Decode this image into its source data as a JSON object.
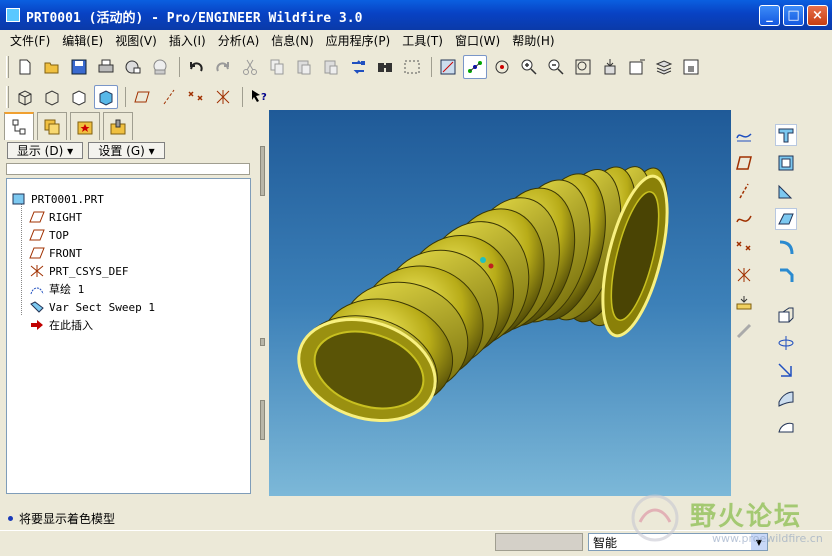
{
  "window": {
    "title": "PRT0001 (活动的) - Pro/ENGINEER Wildfire 3.0",
    "minimize": "_",
    "maximize": "□",
    "close": "×"
  },
  "menu": [
    "文件(F)",
    "编辑(E)",
    "视图(V)",
    "插入(I)",
    "分析(A)",
    "信息(N)",
    "应用程序(P)",
    "工具(T)",
    "窗口(W)",
    "帮助(H)"
  ],
  "toolbar_icons": {
    "row1": [
      "new-file-icon",
      "open-folder-icon",
      "save-icon",
      "print-icon",
      "send-mail-icon",
      "email-link-icon",
      "undo-icon",
      "redo-icon",
      "cut-icon",
      "copy-icon",
      "paste-icon",
      "paste-special-icon",
      "regenerate-icon",
      "find-icon",
      "select-box-icon",
      "datum-display-icon",
      "datum-axis-icon",
      "spin-center-icon",
      "zoom-in-icon",
      "zoom-out-icon",
      "refit-icon",
      "reorient-icon",
      "saved-views-icon",
      "layers-icon",
      "view-manager-icon"
    ],
    "row2": [
      "wireframe-icon",
      "hidden-line-icon",
      "no-hidden-icon",
      "shading-icon",
      "datum-planes-icon",
      "datum-axes-icon",
      "datum-points-icon",
      "coord-systems-icon",
      "context-help-icon"
    ]
  },
  "panel": {
    "show_label": "显示 (D) ▾",
    "settings_label": "设置 (G) ▾"
  },
  "tree": {
    "root": "PRT0001.PRT",
    "items": [
      "RIGHT",
      "TOP",
      "FRONT",
      "PRT_CSYS_DEF",
      "草绘 1",
      "Var Sect Sweep 1",
      "在此插入"
    ]
  },
  "status": {
    "message": "将要显示着色模型",
    "filter_value": "智能"
  },
  "watermark": {
    "text": "野火论坛",
    "url": "www.proewildfire.cn"
  },
  "colors": {
    "title_bar": "#0842c4",
    "model_yellow": "#c8c020",
    "viewport_top": "#1f5a98",
    "viewport_bottom": "#7cb8d8"
  }
}
